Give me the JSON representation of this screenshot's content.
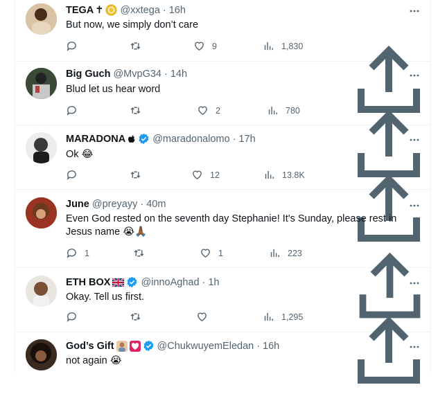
{
  "tweets": [
    {
      "name": "TEGA",
      "flair": "✝",
      "handle": "@xxtega",
      "time": "16h",
      "text": "But now, we simply don’t care",
      "replies": "",
      "retweets": "",
      "likes": "9",
      "views": "1,830",
      "verified": false,
      "badge": "coin"
    },
    {
      "name": "Big Guch",
      "handle": "@MvpG34",
      "time": "14h",
      "text": "Blud let us hear word",
      "replies": "",
      "retweets": "",
      "likes": "2",
      "views": "780",
      "verified": false
    },
    {
      "name": "MARADONA",
      "flair": "",
      "handle": "@maradonalomo",
      "time": "17h",
      "text": "Ok 😂",
      "replies": "",
      "retweets": "",
      "likes": "12",
      "views": "13.8K",
      "verified": true
    },
    {
      "name": "June",
      "handle": "@preyayy",
      "time": "40m",
      "text": "Even God rested on the seventh day Stephanie! It's Sunday, please rest in Jesus name 😭🙏🏾",
      "replies": "1",
      "retweets": "",
      "likes": "1",
      "views": "223",
      "verified": false
    },
    {
      "name": "ETH BOX",
      "handle": "@innoAghad",
      "time": "1h",
      "text": "Okay. Tell us first.",
      "replies": "",
      "retweets": "",
      "likes": "",
      "views": "1,295",
      "verified": true,
      "badge": "flag-uk"
    },
    {
      "name": "God’s Gift",
      "handle": "@ChukwuyemEledan",
      "time": "16h",
      "text": "not again 😭",
      "verified": true,
      "badge": "emoji"
    }
  ],
  "colors": {
    "text": "#0f1419",
    "muted": "#536471",
    "verified": "#1d9bf0",
    "border": "#eff3f4"
  }
}
